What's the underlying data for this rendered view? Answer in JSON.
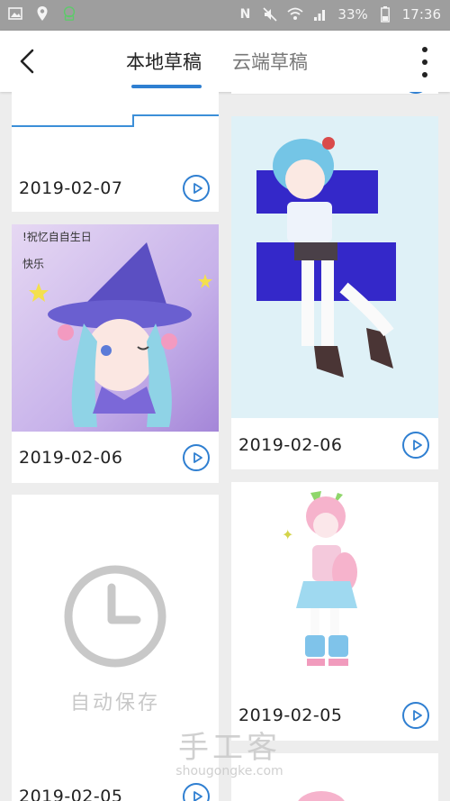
{
  "status_bar": {
    "battery": "33%",
    "time": "17:36"
  },
  "header": {
    "tabs": [
      {
        "label": "本地草稿",
        "active": true
      },
      {
        "label": "云端草稿",
        "active": false
      }
    ]
  },
  "drafts": [
    {
      "date": "2019-02-07",
      "thumbnail": "line-sketch"
    },
    {
      "date": "2019-02-06",
      "thumbnail": "witch-girl-artwork",
      "caption": "!祝忆自自生日快乐"
    },
    {
      "date": "2019-02-06",
      "thumbnail": "blue-hair-girl-artwork"
    },
    {
      "date": "2019-02-05",
      "thumbnail": "pink-hair-girl-artwork"
    },
    {
      "date": "2019-02-05",
      "thumbnail": "autosave-placeholder",
      "placeholder_label": "自动保存"
    }
  ],
  "watermark": {
    "title": "手工客",
    "url": "shougongke.com"
  },
  "colors": {
    "accent": "#2f7fd1",
    "status_bar": "#9e9e9e",
    "background": "#ededed"
  }
}
